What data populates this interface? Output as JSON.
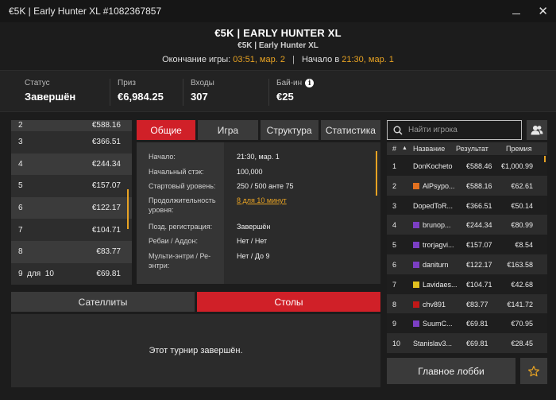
{
  "window": {
    "title": "€5K | Early Hunter XL #1082367857"
  },
  "header": {
    "title": "€5K | EARLY HUNTER XL",
    "subtitle": "€5K | Early Hunter XL",
    "end_label": "Окончание игры:",
    "end_time": "03:51, мар. 2",
    "separator": "|",
    "start_label": "Начало в",
    "start_time": "21:30, мар. 1"
  },
  "stats": [
    {
      "label": "Статус",
      "value": "Завершён"
    },
    {
      "label": "Приз",
      "value": "€6,984.25"
    },
    {
      "label": "Входы",
      "value": "307"
    },
    {
      "label": "Бай-ин",
      "value": "€25"
    }
  ],
  "prizes": [
    {
      "place": "2",
      "amount": "€588.16"
    },
    {
      "place": "3",
      "amount": "€366.51"
    },
    {
      "place": "4",
      "amount": "€244.34"
    },
    {
      "place": "5",
      "amount": "€157.07"
    },
    {
      "place": "6",
      "amount": "€122.17"
    },
    {
      "place": "7",
      "amount": "€104.71"
    },
    {
      "place": "8",
      "amount": "€83.77"
    },
    {
      "place": "9  для  10",
      "amount": "€69.81"
    }
  ],
  "tabs": [
    "Общие",
    "Игра",
    "Структура",
    "Статистика"
  ],
  "info": [
    {
      "label": "Начало:",
      "value": "21:30, мар. 1"
    },
    {
      "label": "Начальный стэк:",
      "value": "100,000"
    },
    {
      "label": "Стартовый уровень:",
      "value": "250 / 500 анте 75"
    },
    {
      "label": "Продолжительность уровня:",
      "value": "8 для 10 минут"
    },
    {
      "label": "Позд. регистрация:",
      "value": "Завершён"
    },
    {
      "label": "Ребаи / Аддон:",
      "value": "Нет / Нет"
    },
    {
      "label": "Мульти-энтри / Ре-энтри:",
      "value": "Нет / До 9"
    }
  ],
  "bottom_tabs": [
    "Сателлиты",
    "Столы"
  ],
  "finished_text": "Этот турнир завершён.",
  "search": {
    "placeholder": "Найти игрока"
  },
  "players_head": {
    "num": "#",
    "name": "Название",
    "result": "Результат",
    "bonus": "Премия"
  },
  "players": [
    {
      "rank": "1",
      "name": "DonKocheto",
      "flag": "",
      "result": "€588.46",
      "bonus": "€1,000.99"
    },
    {
      "rank": "2",
      "name": "AlPsypo...",
      "flag": "#e07020",
      "result": "€588.16",
      "bonus": "€62.61"
    },
    {
      "rank": "3",
      "name": "DopedToR...",
      "flag": "",
      "result": "€366.51",
      "bonus": "€50.14"
    },
    {
      "rank": "4",
      "name": "brunop...",
      "flag": "#7b3fc4",
      "result": "€244.34",
      "bonus": "€80.99"
    },
    {
      "rank": "5",
      "name": "trorjagvi...",
      "flag": "#7b3fc4",
      "result": "€157.07",
      "bonus": "€8.54"
    },
    {
      "rank": "6",
      "name": "daniturn",
      "flag": "#7b3fc4",
      "result": "€122.17",
      "bonus": "€163.58"
    },
    {
      "rank": "7",
      "name": "Lavidaes...",
      "flag": "#e0c020",
      "result": "€104.71",
      "bonus": "€42.68"
    },
    {
      "rank": "8",
      "name": "chv891",
      "flag": "#c01818",
      "result": "€83.77",
      "bonus": "€141.72"
    },
    {
      "rank": "9",
      "name": "SuumC...",
      "flag": "#7b3fc4",
      "result": "€69.81",
      "bonus": "€70.95"
    },
    {
      "rank": "10",
      "name": "Stanislav3...",
      "flag": "",
      "result": "€69.81",
      "bonus": "€28.45"
    }
  ],
  "lobby_button": "Главное лобби",
  "colors": {
    "accent": "#d02028",
    "highlight": "#e8a323"
  }
}
